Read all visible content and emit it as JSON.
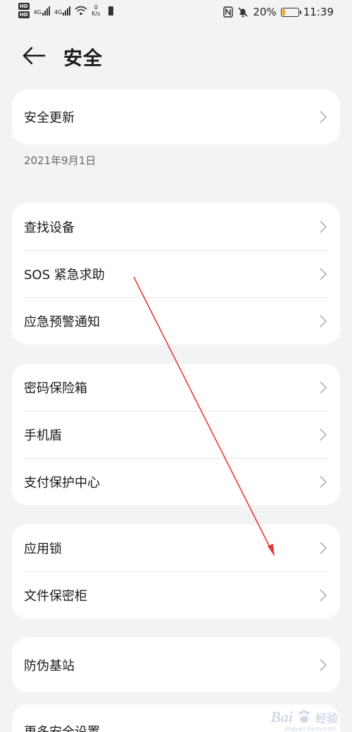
{
  "status_bar": {
    "hd1": "HD",
    "hd2": "HD",
    "net1": "4G",
    "net2": "4G",
    "speed_value": "0",
    "speed_unit": "K/s",
    "battery_percent": "20%",
    "battery_level": 0.2,
    "time": "11:39"
  },
  "header": {
    "title": "安全"
  },
  "security_update": {
    "label": "安全更新",
    "date": "2021年9月1日"
  },
  "group1": [
    {
      "label": "查找设备"
    },
    {
      "label": "SOS 紧急求助"
    },
    {
      "label": "应急预警通知"
    }
  ],
  "group2": [
    {
      "label": "密码保险箱"
    },
    {
      "label": "手机盾"
    },
    {
      "label": "支付保护中心"
    }
  ],
  "group3": [
    {
      "label": "应用锁"
    },
    {
      "label": "文件保密柜"
    }
  ],
  "group4": [
    {
      "label": "防伪基站"
    }
  ],
  "group5": [
    {
      "label": "更多安全设置"
    }
  ],
  "colors": {
    "background": "#f1f3f5",
    "card": "#ffffff",
    "annotation_arrow": "#e53935",
    "battery_fill": "#f5a623"
  },
  "watermark": {
    "logo": "Bai",
    "text": "经验",
    "url": "jingyan.baidu.com"
  }
}
